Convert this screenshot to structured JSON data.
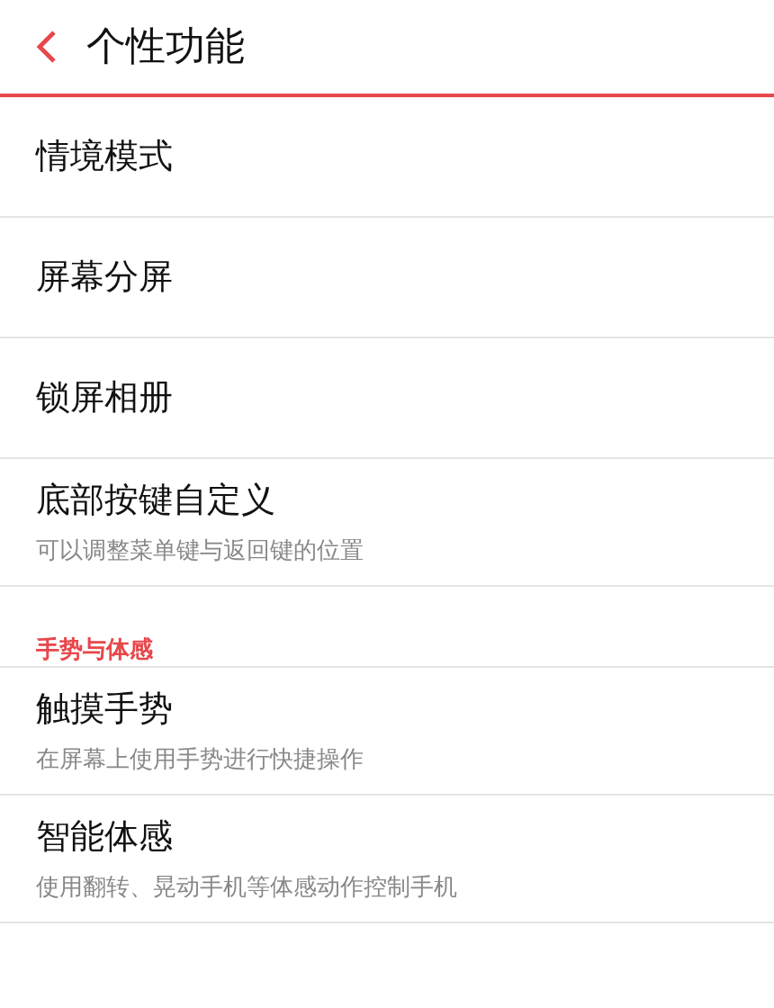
{
  "header": {
    "title": "个性功能"
  },
  "items": [
    {
      "title": "情境模式"
    },
    {
      "title": "屏幕分屏"
    },
    {
      "title": "锁屏相册"
    },
    {
      "title": "底部按键自定义",
      "subtitle": "可以调整菜单键与返回键的位置"
    }
  ],
  "section": {
    "title": "手势与体感",
    "items": [
      {
        "title": "触摸手势",
        "subtitle": "在屏幕上使用手势进行快捷操作"
      },
      {
        "title": "智能体感",
        "subtitle": "使用翻转、晃动手机等体感动作控制手机"
      }
    ]
  }
}
